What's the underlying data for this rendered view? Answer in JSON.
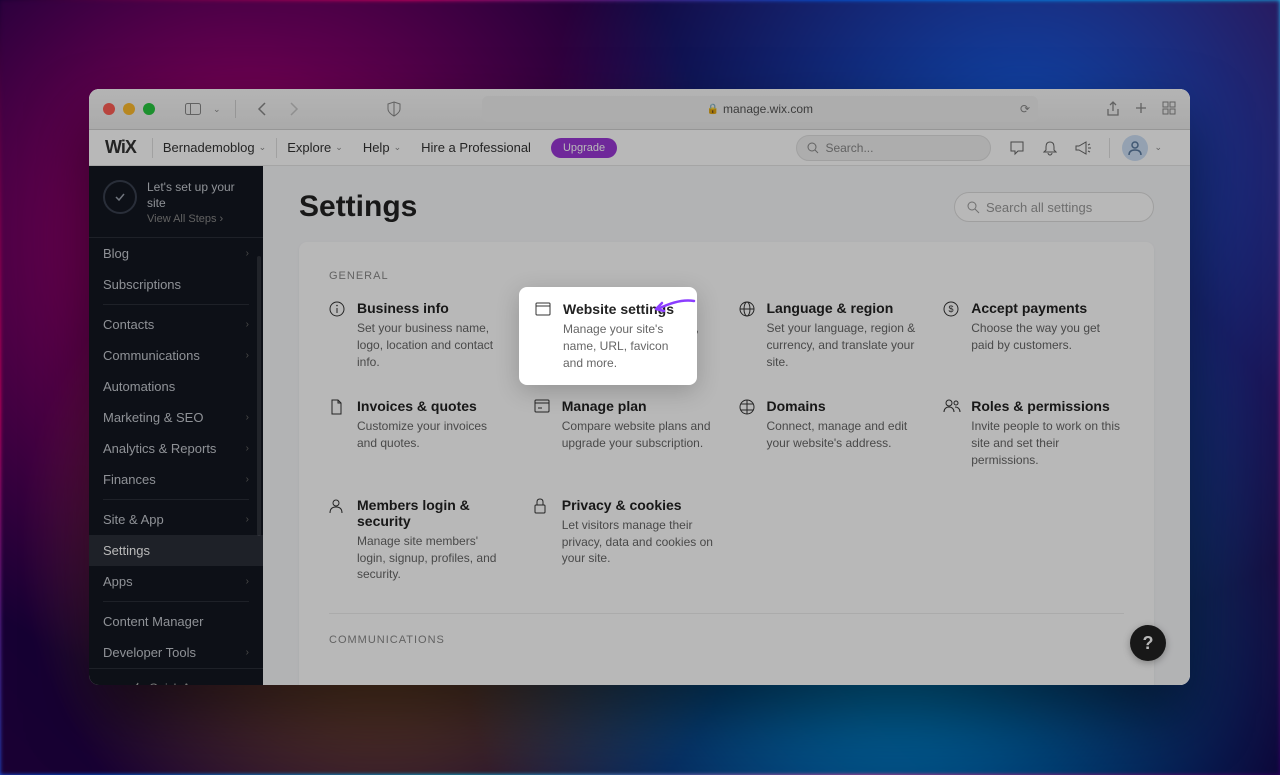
{
  "browser": {
    "url": "manage.wix.com"
  },
  "topbar": {
    "logo": "WiX",
    "site_name": "Bernademoblog",
    "explore": "Explore",
    "help": "Help",
    "hire": "Hire a Professional",
    "upgrade": "Upgrade",
    "search_placeholder": "Search..."
  },
  "setup": {
    "title": "Let's set up your site",
    "link": "View All Steps"
  },
  "sidebar": [
    {
      "label": "Blog",
      "chev": true
    },
    {
      "label": "Subscriptions",
      "chev": false
    },
    {
      "sep": true
    },
    {
      "label": "Contacts",
      "chev": true
    },
    {
      "label": "Communications",
      "chev": true
    },
    {
      "label": "Automations",
      "chev": false
    },
    {
      "label": "Marketing & SEO",
      "chev": true
    },
    {
      "label": "Analytics & Reports",
      "chev": true
    },
    {
      "label": "Finances",
      "chev": true
    },
    {
      "sep": true
    },
    {
      "label": "Site & App",
      "chev": true
    },
    {
      "label": "Settings",
      "chev": false,
      "active": true
    },
    {
      "label": "Apps",
      "chev": true
    },
    {
      "sep": true
    },
    {
      "label": "Content Manager",
      "chev": false
    },
    {
      "label": "Developer Tools",
      "chev": true
    }
  ],
  "quick_access": "Quick Access",
  "page": {
    "title": "Settings",
    "search_placeholder": "Search all settings"
  },
  "sections": {
    "general": "GENERAL",
    "communications": "COMMUNICATIONS"
  },
  "cards": {
    "business_info": {
      "title": "Business info",
      "desc": "Set your business name, logo, location and contact info."
    },
    "website_settings": {
      "title": "Website settings",
      "desc": "Manage your site's name, URL, favicon and more."
    },
    "language_region": {
      "title": "Language & region",
      "desc": "Set your language, region & currency, and translate your site."
    },
    "accept_payments": {
      "title": "Accept payments",
      "desc": "Choose the way you get paid by customers."
    },
    "invoices_quotes": {
      "title": "Invoices & quotes",
      "desc": "Customize your invoices and quotes."
    },
    "manage_plan": {
      "title": "Manage plan",
      "desc": "Compare website plans and upgrade your subscription."
    },
    "domains": {
      "title": "Domains",
      "desc": "Connect, manage and edit your website's address."
    },
    "roles_permissions": {
      "title": "Roles & permissions",
      "desc": "Invite people to work on this site and set their permissions."
    },
    "members_login": {
      "title": "Members login & security",
      "desc": "Manage site members' login, signup, profiles, and security."
    },
    "privacy_cookies": {
      "title": "Privacy & cookies",
      "desc": "Let visitors manage their privacy, data and cookies on your site."
    }
  },
  "help_button": "?"
}
